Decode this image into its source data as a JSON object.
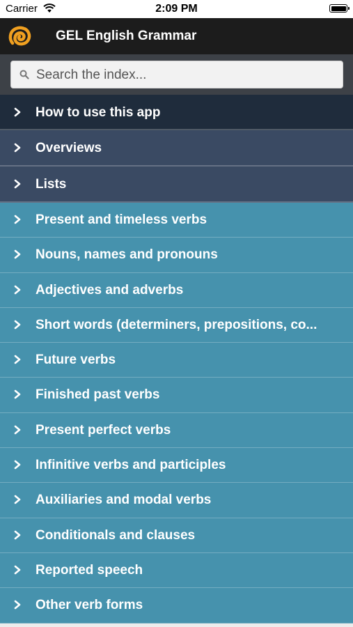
{
  "status_bar": {
    "carrier": "Carrier",
    "time": "2:09 PM"
  },
  "nav_bar": {
    "title": "GEL English Grammar",
    "logo_icon": "gel-spiral-logo-icon",
    "logo_color": "#f0a020"
  },
  "search": {
    "placeholder": "Search the index..."
  },
  "colors": {
    "dark_row": "#1f2c3c",
    "mid_row": "#3a4a63",
    "teal_row": "#4692ad"
  },
  "list": {
    "items": [
      {
        "label": "How to use this app"
      },
      {
        "label": "Overviews"
      },
      {
        "label": "Lists"
      },
      {
        "label": "Present and timeless verbs"
      },
      {
        "label": "Nouns, names and pronouns"
      },
      {
        "label": "Adjectives and adverbs"
      },
      {
        "label": "Short words (determiners, prepositions, co..."
      },
      {
        "label": "Future verbs"
      },
      {
        "label": "Finished past verbs"
      },
      {
        "label": "Present perfect verbs"
      },
      {
        "label": "Infinitive verbs and participles"
      },
      {
        "label": "Auxiliaries and modal verbs"
      },
      {
        "label": "Conditionals and clauses"
      },
      {
        "label": "Reported speech"
      },
      {
        "label": "Other verb forms"
      }
    ]
  }
}
